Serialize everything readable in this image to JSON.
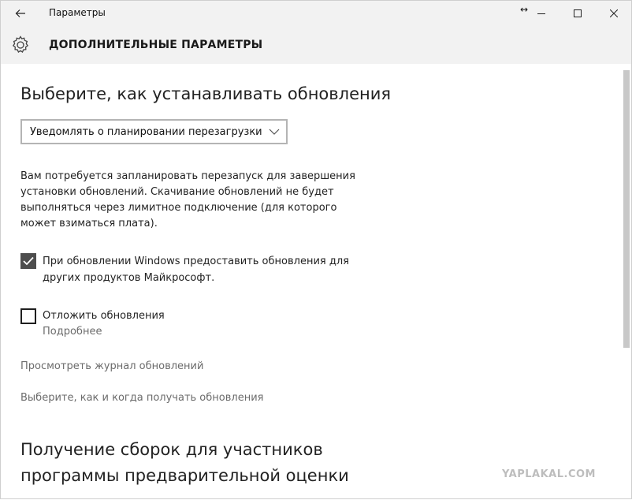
{
  "window": {
    "title": "Параметры",
    "icons": {
      "back": "back-arrow-icon",
      "resize": "resize-arrows-icon",
      "minimize": "minimize-icon",
      "maximize": "maximize-icon",
      "close": "close-icon",
      "settings": "gear-icon"
    }
  },
  "header": {
    "title": "ДОПОЛНИТЕЛЬНЫЕ ПАРАМЕТРЫ"
  },
  "updates": {
    "heading": "Выберите, как устанавливать обновления",
    "mode_selected": "Уведомлять о планировании перезагрузки",
    "description": "Вам потребуется запланировать перезапуск для завершения установки обновлений. Скачивание обновлений не будет выполняться через лимитное подключение (для которого может взиматься плата).",
    "other_products": {
      "checked": true,
      "label_line1": "При обновлении Windows предоставить обновления для",
      "label_line2": "других продуктов Майкрософт."
    },
    "defer": {
      "checked": false,
      "label": "Отложить обновления",
      "more_link": "Подробнее"
    },
    "history_link": "Просмотреть журнал обновлений",
    "delivery_link": "Выберите, как и когда получать обновления"
  },
  "insider": {
    "heading_line1": "Получение сборок для участников",
    "heading_line2": "программы предварительной оценки"
  },
  "watermark": "YAPLAKAL.COM",
  "colors": {
    "titlebar_bg": "#f2f2f2",
    "link": "#6b6b6b",
    "checkbox_fill": "#4d4d4d"
  }
}
